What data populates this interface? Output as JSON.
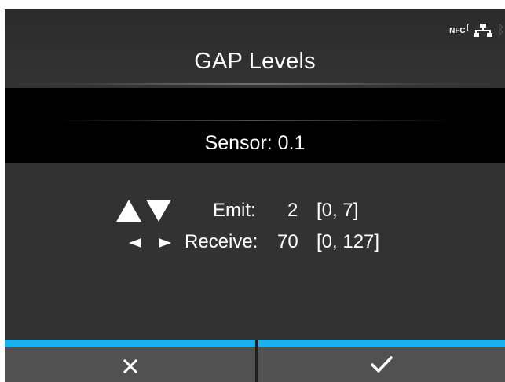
{
  "header": {
    "title": "GAP Levels",
    "status_icons": [
      "nfc-icon",
      "network-icon",
      "bluetooth-icon"
    ],
    "nfc_label": "NFC"
  },
  "sensor": {
    "label": "Sensor: 0.1"
  },
  "levels": {
    "emit": {
      "label": "Emit:",
      "value": "2",
      "range": "[0, 7]"
    },
    "receive": {
      "label": "Receive:",
      "value": "70",
      "range": "[0, 127]"
    }
  },
  "buttons": {
    "cancel_icon": "close-icon",
    "confirm_icon": "check-icon"
  },
  "colors": {
    "accent": "#19b2ec",
    "background": "#323232",
    "band": "#000000",
    "button": "#515151"
  }
}
